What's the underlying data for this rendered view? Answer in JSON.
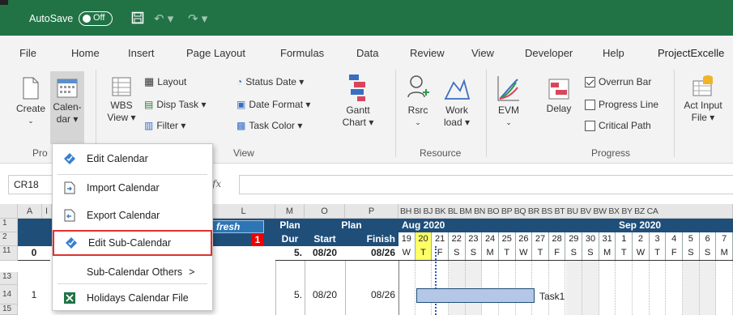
{
  "titlebar": {
    "autosave": "AutoSave",
    "toggle": "Off"
  },
  "tabs": [
    "File",
    "Home",
    "Insert",
    "Page Layout",
    "Formulas",
    "Data",
    "Review",
    "View",
    "Developer",
    "Help",
    "ProjectExcelle"
  ],
  "ribbon": {
    "create": "Create",
    "calendar_line1": "Calen-",
    "calendar_line2": "dar ▾",
    "wbs_line1": "WBS",
    "wbs_line2": "View ▾",
    "layout": "Layout",
    "disp_task": "Disp Task ▾",
    "filter": "Filter ▾",
    "status_date": "Status Date ▾",
    "date_format": "Date Format ▾",
    "task_color": "Task Color ▾",
    "gantt_line1": "Gantt",
    "gantt_line2": "Chart ▾",
    "rsrc": "Rsrc",
    "work_line1": "Work",
    "work_line2": "load ▾",
    "evm": "EVM",
    "delay": "Delay",
    "overrun_bar": "Overrun Bar",
    "progress_line": "Progress Line",
    "critical_path": "Critical Path",
    "act_input_line1": "Act Input",
    "act_input_line2": "File ▾",
    "group_project": "Pro",
    "group_view": "View",
    "group_resource": "Resource",
    "group_progress": "Progress"
  },
  "formula": {
    "namebox": "CR18",
    "fx": "fx"
  },
  "grid": {
    "cols": [
      "A",
      "I",
      "L",
      "M",
      "O",
      "P"
    ],
    "gantt_cols": "BH BI BJ BK BL BM BN BO BP BQ BR BS BT BU BV BW BX BY BZ CA",
    "rows": [
      "1",
      "2",
      "11",
      "13",
      "14",
      "15"
    ],
    "plan_dur_1": "Plan",
    "plan_dur_2": "Dur",
    "plan": "Plan",
    "start": "Start",
    "finish": "Finish",
    "month1": "Aug 2020",
    "month2": "Sep 2020",
    "days": [
      "19",
      "20",
      "21",
      "22",
      "23",
      "24",
      "25",
      "26",
      "27",
      "28",
      "29",
      "30",
      "31",
      "1",
      "2",
      "3",
      "4",
      "5",
      "6",
      "7"
    ],
    "weekdays": [
      "W",
      "T",
      "F",
      "S",
      "S",
      "M",
      "T",
      "W",
      "T",
      "F",
      "S",
      "S",
      "M",
      "T",
      "W",
      "T",
      "F",
      "S",
      "S",
      "M"
    ],
    "refresh": "fresh",
    "badge": "1",
    "r11_a": "0",
    "r11_dur": "5.",
    "r11_start": "08/20",
    "r11_finish": "08/26",
    "r14_a": "1",
    "r14_dur": "5.",
    "r14_start": "08/20",
    "r14_finish": "08/26",
    "task1": "Task1"
  },
  "menu": {
    "items": [
      "Edit Calendar",
      "Import Calendar",
      "Export Calendar",
      "Edit Sub-Calendar",
      "Sub-Calendar Others",
      "Holidays Calendar File"
    ],
    "submenu_arrow": ">"
  },
  "colors": {
    "excel_green": "#217346",
    "header_blue": "#1f4e79",
    "highlight_red": "#e03030"
  }
}
